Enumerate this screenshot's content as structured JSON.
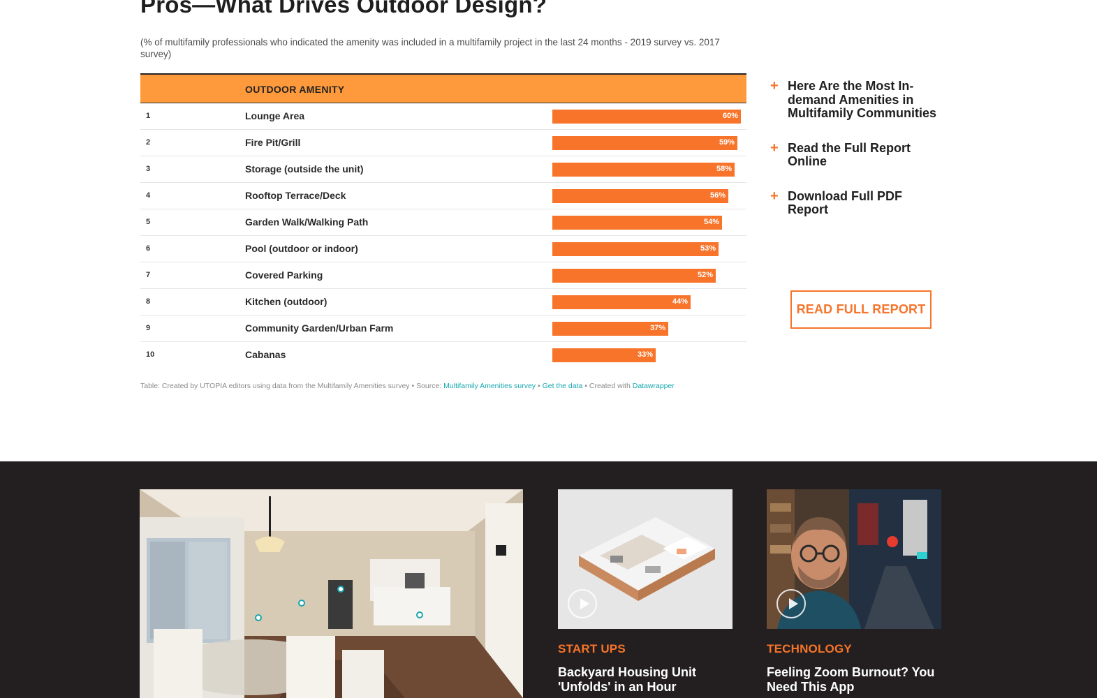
{
  "article": {
    "title": "Pros—What Drives Outdoor Design?",
    "subtitle": "(% of multifamily professionals who indicated the amenity was included in a multifamily project in the last 24 months - 2019 survey vs. 2017 survey)"
  },
  "table": {
    "header": "OUTDOOR AMENITY",
    "bar_color": "#f7742a",
    "header_color": "#ff9a3c",
    "rows": [
      {
        "rank": "1",
        "amenity": "Lounge Area",
        "label": "60%",
        "value": 60
      },
      {
        "rank": "2",
        "amenity": "Fire Pit/Grill",
        "label": "59%",
        "value": 59
      },
      {
        "rank": "3",
        "amenity": "Storage (outside the unit)",
        "label": "58%",
        "value": 58
      },
      {
        "rank": "4",
        "amenity": "Rooftop Terrace/Deck",
        "label": "56%",
        "value": 56
      },
      {
        "rank": "5",
        "amenity": "Garden Walk/Walking Path",
        "label": "54%",
        "value": 54
      },
      {
        "rank": "6",
        "amenity": "Pool (outdoor or indoor)",
        "label": "53%",
        "value": 53
      },
      {
        "rank": "7",
        "amenity": "Covered Parking",
        "label": "52%",
        "value": 52
      },
      {
        "rank": "8",
        "amenity": "Kitchen (outdoor)",
        "label": "44%",
        "value": 44
      },
      {
        "rank": "9",
        "amenity": "Community Garden/Urban Farm",
        "label": "37%",
        "value": 37
      },
      {
        "rank": "10",
        "amenity": "Cabanas",
        "label": "33%",
        "value": 33
      }
    ]
  },
  "footnote": {
    "prefix": "Table: Created by UTOPIA editors using data from the Multifamily Amenities survey • Source: ",
    "source_link": "Multifamily Amenities survey",
    "sep1": " • ",
    "data_link": "Get the data",
    "sep2": " • Created with ",
    "tool_link": "Datawrapper"
  },
  "sidebar": {
    "links": [
      {
        "text": "Here Are the Most In-demand Amenities in Multifamily Communities"
      },
      {
        "text": "Read the Full Report Online"
      },
      {
        "text": "Download Full PDF Report"
      }
    ],
    "button_label": "READ FULL REPORT"
  },
  "cards": [
    {
      "category": "START UPS",
      "title": "Backyard Housing Unit 'Unfolds' in an Hour"
    },
    {
      "category": "TECHNOLOGY",
      "title": "Feeling Zoom Burnout? You Need This App"
    }
  ],
  "colors": {
    "accent": "#f7742a",
    "dark_bg": "#231f20",
    "link": "#15a7b0"
  }
}
